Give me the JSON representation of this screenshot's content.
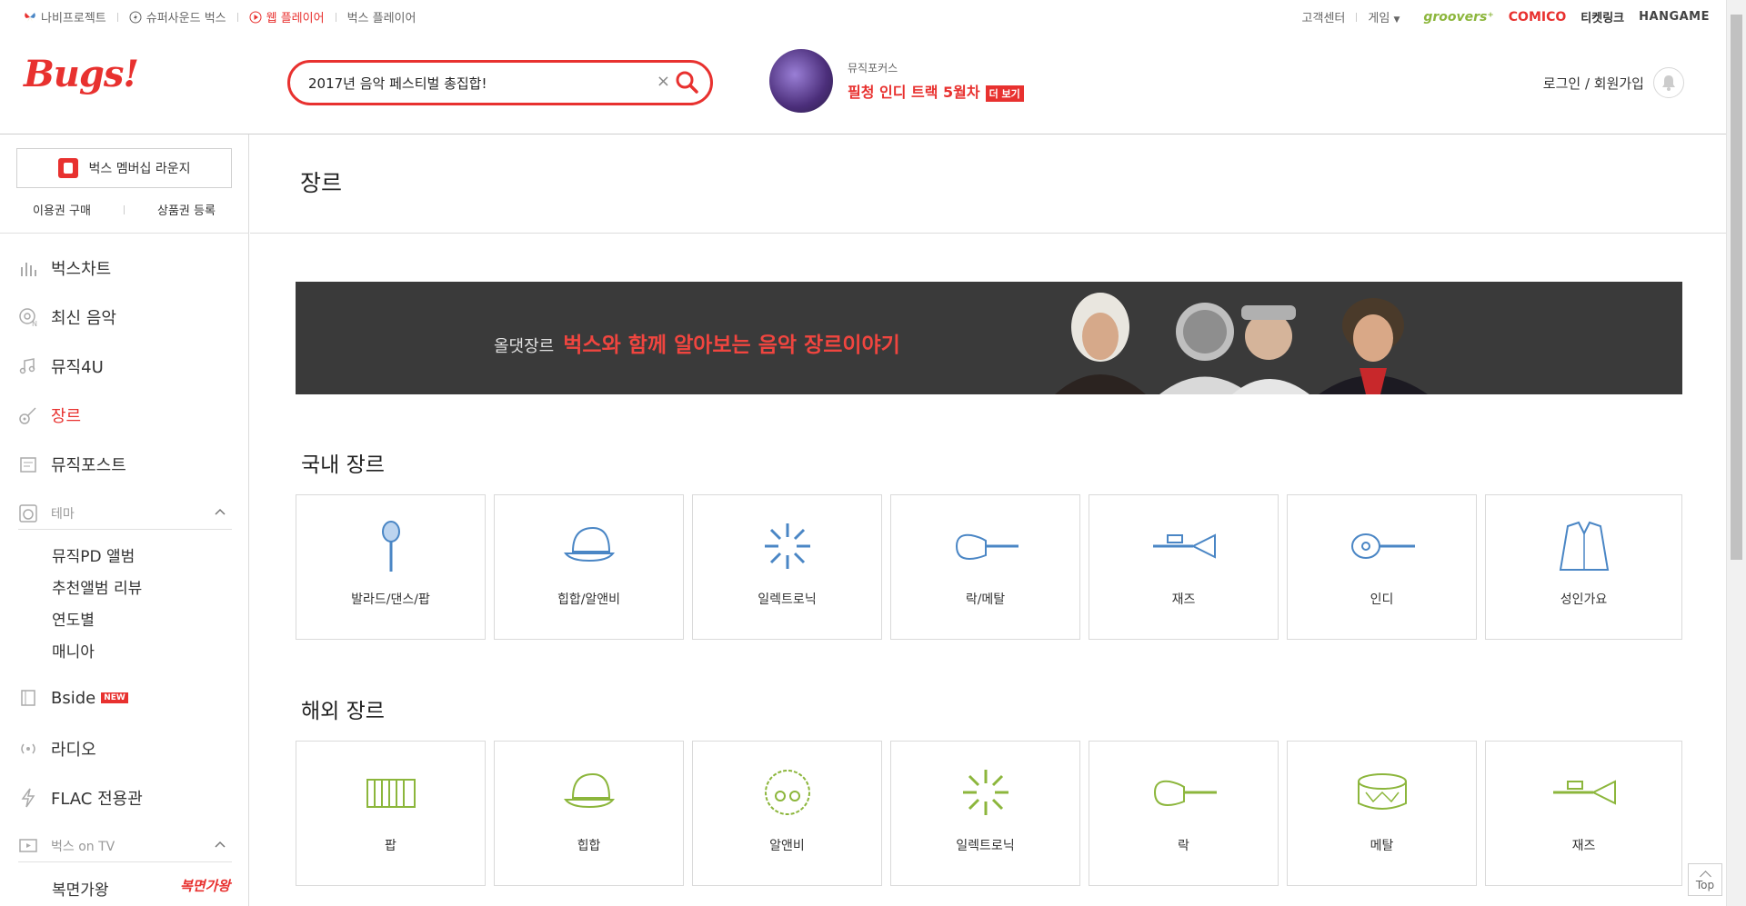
{
  "colors": {
    "accent": "#e8312f",
    "green": "#8cb63c",
    "blue": "#4a86c5"
  },
  "topbar": {
    "left_links": [
      {
        "label": "나비프로젝트",
        "icon": "butterfly-icon"
      },
      {
        "label": "슈퍼사운드 벅스",
        "icon": "lightning-circle-icon"
      },
      {
        "label": "웹 플레이어",
        "icon": "play-circle-icon"
      },
      {
        "label": "벅스 플레이어",
        "icon": ""
      }
    ],
    "help": "고객센터",
    "game": "게임",
    "brands": [
      "groovers⁺",
      "COMICO",
      "티켓링크",
      "HANGAME"
    ]
  },
  "header": {
    "logo": "Bugs!",
    "search_value": "2017년 음악 페스티벌 총집합!",
    "focus_small": "뮤직포커스",
    "focus_title": "필청 인디 트랙 5월차",
    "focus_more": "더 보기",
    "login": "로그인 / 회원가입"
  },
  "sidebar": {
    "member_lounge": "벅스 멤버십 라운지",
    "buy_pass": "이용권 구매",
    "register_voucher": "상품권 등록",
    "nav": [
      {
        "label": "벅스차트",
        "icon": "bar-chart-icon"
      },
      {
        "label": "최신 음악",
        "icon": "new-music-icon"
      },
      {
        "label": "뮤직4U",
        "icon": "music-note-icon"
      },
      {
        "label": "장르",
        "icon": "guitar-icon"
      },
      {
        "label": "뮤직포스트",
        "icon": "post-icon"
      }
    ],
    "theme_group": "테마",
    "theme_items": [
      "뮤직PD 앨범",
      "추천앨범 리뷰",
      "연도별",
      "매니아"
    ],
    "bside": "Bside",
    "new_tag": "NEW",
    "radio": "라디오",
    "flac": "FLAC 전용관",
    "tv_group": "벅스 on TV",
    "tv_items": [
      "복면가왕"
    ],
    "tv_logo_text": "복면가왕"
  },
  "main": {
    "title": "장르",
    "banner_small": "올댓장르",
    "banner_big": "벅스와 함께 알아보는 음악 장르이야기",
    "domestic_title": "국내 장르",
    "domestic": [
      {
        "label": "발라드/댄스/팝",
        "icon": "microphone-icon"
      },
      {
        "label": "힙합/알앤비",
        "icon": "cap-icon"
      },
      {
        "label": "일렉트로닉",
        "icon": "burst-icon"
      },
      {
        "label": "락/메탈",
        "icon": "electric-guitar-icon"
      },
      {
        "label": "재즈",
        "icon": "trumpet-icon"
      },
      {
        "label": "인디",
        "icon": "acoustic-guitar-icon"
      },
      {
        "label": "성인가요",
        "icon": "jacket-icon"
      }
    ],
    "foreign_title": "해외 장르",
    "foreign": [
      {
        "label": "팝",
        "icon": "keyboard-icon"
      },
      {
        "label": "힙합",
        "icon": "cap-icon"
      },
      {
        "label": "알앤비",
        "icon": "afro-icon"
      },
      {
        "label": "일렉트로닉",
        "icon": "burst-icon"
      },
      {
        "label": "락",
        "icon": "electric-guitar-icon"
      },
      {
        "label": "메탈",
        "icon": "drum-icon"
      },
      {
        "label": "재즈",
        "icon": "trumpet-icon"
      }
    ]
  },
  "top_button": "Top"
}
